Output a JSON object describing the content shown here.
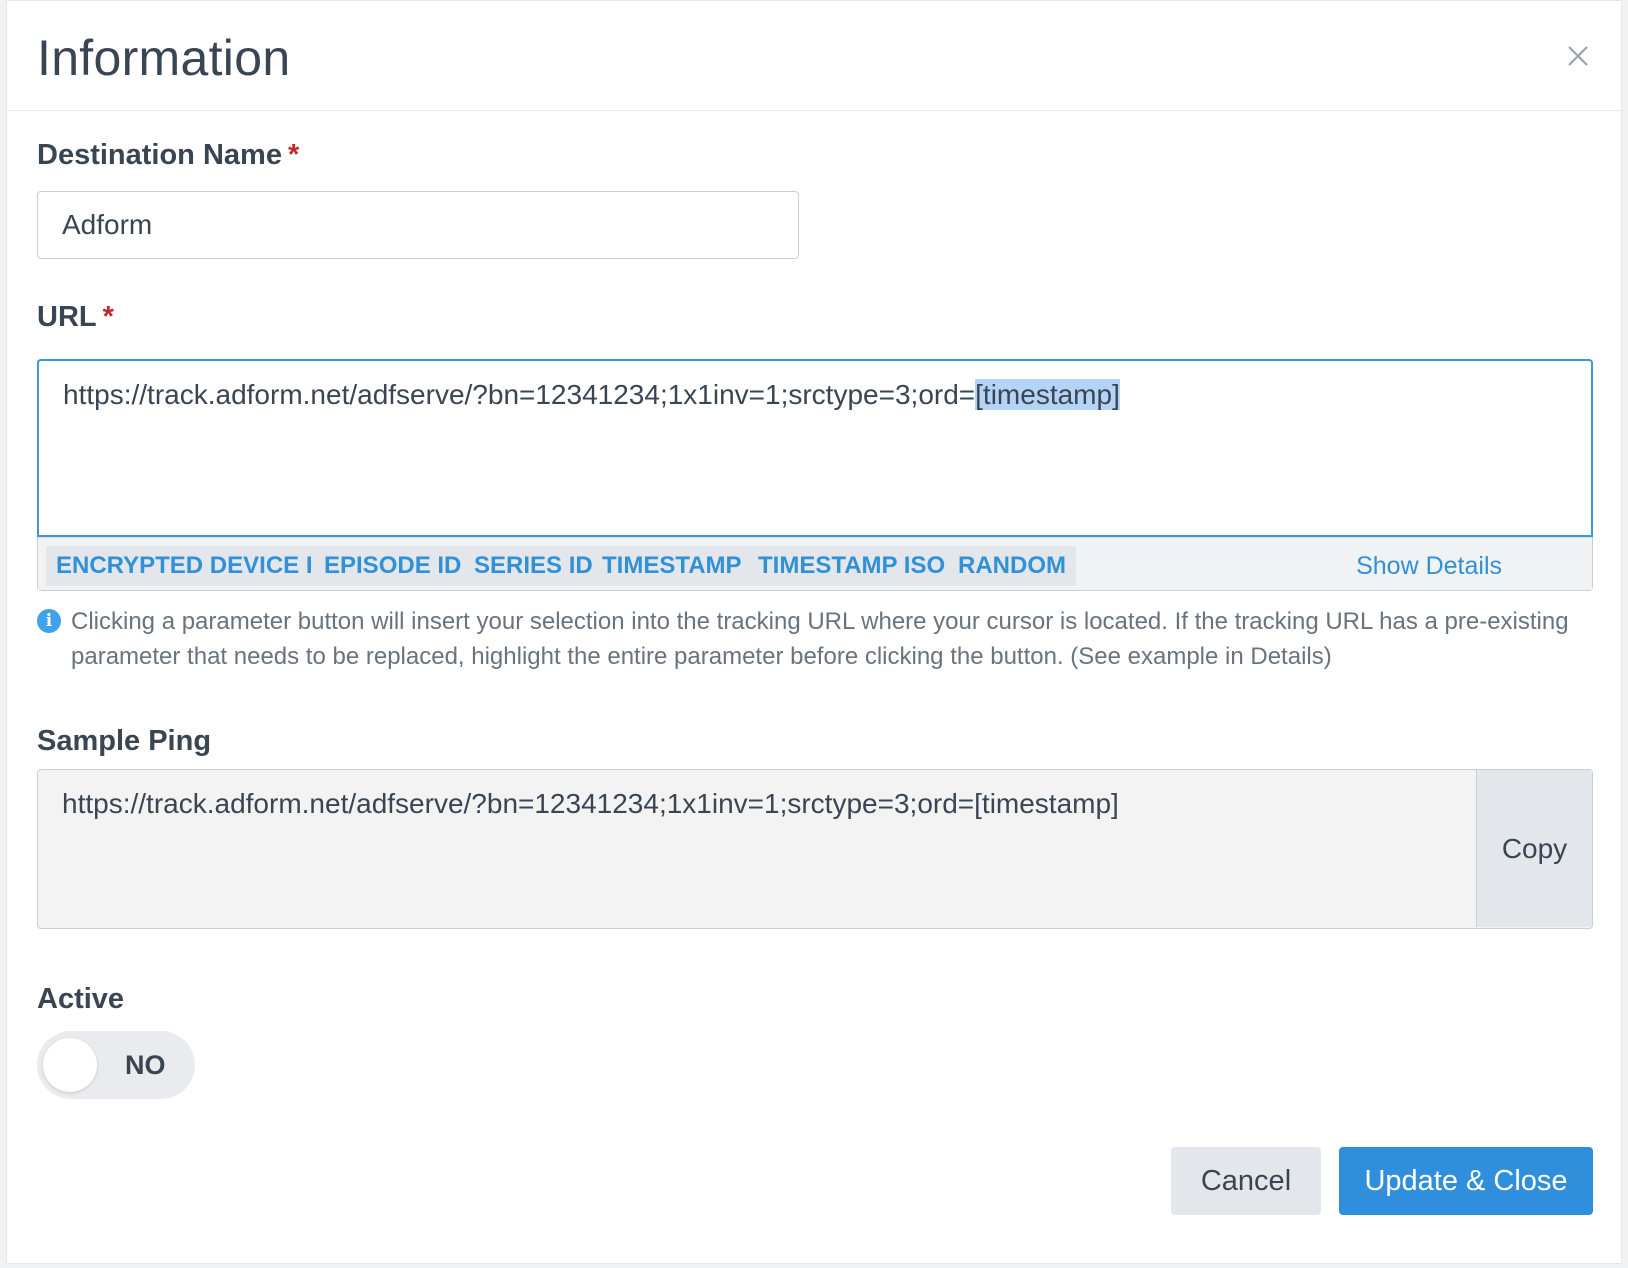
{
  "modal": {
    "title": "Information",
    "close_icon": "close-icon"
  },
  "fields": {
    "destination_name": {
      "label": "Destination Name",
      "required_mark": "*",
      "value": "Adform"
    },
    "url": {
      "label": "URL",
      "required_mark": "*",
      "value_prefix": "https://track.adform.net/adfserve/?bn=12341234;1x1inv=1;srctype=3;ord=",
      "value_selected": "[timestamp]"
    },
    "parameters": [
      "ENCRYPTED DEVICE IP",
      "EPISODE ID",
      "SERIES ID",
      "TIMESTAMP",
      "TIMESTAMP ISO",
      "RANDOM"
    ],
    "show_details_label": "Show Details",
    "help_icon": "info-icon",
    "help_text": "Clicking a parameter button will insert your selection into the tracking URL where your cursor is located. If the tracking URL has a pre-existing parameter that needs to be replaced, highlight the entire parameter before clicking the button. (See example in Details)",
    "sample_ping": {
      "label": "Sample Ping",
      "value": "https://track.adform.net/adfserve/?bn=12341234;1x1inv=1;srctype=3;ord=[timestamp]",
      "copy_label": "Copy"
    },
    "active": {
      "label": "Active",
      "state_label": "NO",
      "on": false
    }
  },
  "footer": {
    "cancel_label": "Cancel",
    "primary_label": "Update & Close"
  },
  "colors": {
    "accent": "#2f8fdc",
    "selection": "#b3d4f7",
    "required": "#c1262f"
  }
}
